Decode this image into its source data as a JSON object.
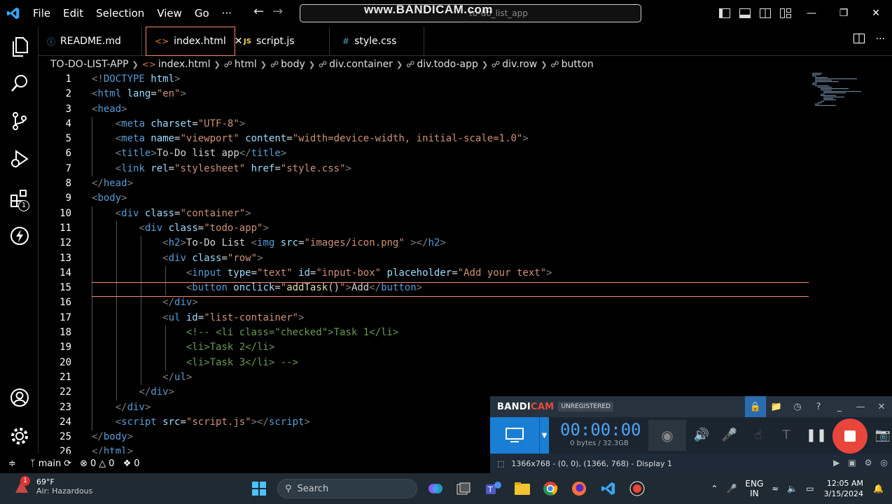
{
  "titlebar": {
    "menu": [
      "File",
      "Edit",
      "Selection",
      "View",
      "Go",
      "···"
    ],
    "search_text": "to-do_list_app",
    "watermark": "www.BANDICAM.com"
  },
  "tabs": [
    {
      "label": "README.md",
      "icon": "info-icon"
    },
    {
      "label": "index.html",
      "icon": "html-icon",
      "active": true
    },
    {
      "label": "script.js",
      "icon": "js-icon"
    },
    {
      "label": "style.css",
      "icon": "css-icon"
    }
  ],
  "breadcrumb": [
    "TO-DO-LIST-APP",
    "index.html",
    "html",
    "body",
    "div.container",
    "div.todo-app",
    "div.row",
    "button"
  ],
  "editor": {
    "lines": [
      [
        [
          "t",
          "<!"
        ],
        [
          "tg",
          "DOCTYPE"
        ],
        [
          "at",
          " html"
        ],
        [
          "t",
          ">"
        ]
      ],
      [
        [
          "t",
          "<"
        ],
        [
          "tg",
          "html"
        ],
        [
          "at",
          " lang"
        ],
        [
          "tx",
          "="
        ],
        [
          "st",
          "\"en\""
        ],
        [
          "t",
          ">"
        ]
      ],
      [
        [
          "t",
          "<"
        ],
        [
          "tg",
          "head"
        ],
        [
          "t",
          ">"
        ]
      ],
      [
        [
          "tx",
          "    "
        ],
        [
          "t",
          "<"
        ],
        [
          "tg",
          "meta"
        ],
        [
          "at",
          " charset"
        ],
        [
          "tx",
          "="
        ],
        [
          "st",
          "\"UTF-8\""
        ],
        [
          "t",
          ">"
        ]
      ],
      [
        [
          "tx",
          "    "
        ],
        [
          "t",
          "<"
        ],
        [
          "tg",
          "meta"
        ],
        [
          "at",
          " name"
        ],
        [
          "tx",
          "="
        ],
        [
          "st",
          "\"viewport\""
        ],
        [
          "at",
          " content"
        ],
        [
          "tx",
          "="
        ],
        [
          "st",
          "\"width=device-width, initial-scale=1.0\""
        ],
        [
          "t",
          ">"
        ]
      ],
      [
        [
          "tx",
          "    "
        ],
        [
          "t",
          "<"
        ],
        [
          "tg",
          "title"
        ],
        [
          "t",
          ">"
        ],
        [
          "tx",
          "To-Do list app"
        ],
        [
          "t",
          "</"
        ],
        [
          "tg",
          "title"
        ],
        [
          "t",
          ">"
        ]
      ],
      [
        [
          "tx",
          "    "
        ],
        [
          "t",
          "<"
        ],
        [
          "tg",
          "link"
        ],
        [
          "at",
          " rel"
        ],
        [
          "tx",
          "="
        ],
        [
          "st",
          "\"stylesheet\""
        ],
        [
          "at",
          " href"
        ],
        [
          "tx",
          "="
        ],
        [
          "st",
          "\"style.css\""
        ],
        [
          "t",
          ">"
        ]
      ],
      [
        [
          "t",
          "</"
        ],
        [
          "tg",
          "head"
        ],
        [
          "t",
          ">"
        ]
      ],
      [
        [
          "t",
          "<"
        ],
        [
          "tg",
          "body"
        ],
        [
          "t",
          ">"
        ]
      ],
      [
        [
          "tx",
          "    "
        ],
        [
          "t",
          "<"
        ],
        [
          "tg",
          "div"
        ],
        [
          "at",
          " class"
        ],
        [
          "tx",
          "="
        ],
        [
          "st",
          "\"container\""
        ],
        [
          "t",
          ">"
        ]
      ],
      [
        [
          "tx",
          "        "
        ],
        [
          "t",
          "<"
        ],
        [
          "tg",
          "div"
        ],
        [
          "at",
          " class"
        ],
        [
          "tx",
          "="
        ],
        [
          "st",
          "\"todo-app\""
        ],
        [
          "t",
          ">"
        ]
      ],
      [
        [
          "tx",
          "            "
        ],
        [
          "t",
          "<"
        ],
        [
          "tg",
          "h2"
        ],
        [
          "t",
          ">"
        ],
        [
          "tx",
          "To-Do List "
        ],
        [
          "t",
          "<"
        ],
        [
          "tg",
          "img"
        ],
        [
          "at",
          " src"
        ],
        [
          "tx",
          "="
        ],
        [
          "st",
          "\"images/icon.png\""
        ],
        [
          "t",
          " ></"
        ],
        [
          "tg",
          "h2"
        ],
        [
          "t",
          ">"
        ]
      ],
      [
        [
          "tx",
          "            "
        ],
        [
          "t",
          "<"
        ],
        [
          "tg",
          "div"
        ],
        [
          "at",
          " class"
        ],
        [
          "tx",
          "="
        ],
        [
          "st",
          "\"row\""
        ],
        [
          "t",
          ">"
        ]
      ],
      [
        [
          "tx",
          "                "
        ],
        [
          "t",
          "<"
        ],
        [
          "tg",
          "input"
        ],
        [
          "at",
          " type"
        ],
        [
          "tx",
          "="
        ],
        [
          "st",
          "\"text\""
        ],
        [
          "at",
          " id"
        ],
        [
          "tx",
          "="
        ],
        [
          "st",
          "\"input-box\""
        ],
        [
          "at",
          " placeholder"
        ],
        [
          "tx",
          "="
        ],
        [
          "st",
          "\"Add your text\""
        ],
        [
          "t",
          ">"
        ]
      ],
      [
        [
          "tx",
          "                "
        ],
        [
          "t",
          "<"
        ],
        [
          "tg",
          "button"
        ],
        [
          "at",
          " onclick"
        ],
        [
          "tx",
          "="
        ],
        [
          "st",
          "\""
        ],
        [
          "fn",
          "addTask"
        ],
        [
          "tx",
          "()"
        ],
        [
          "st",
          "\""
        ],
        [
          "t",
          ">"
        ],
        [
          "tx",
          "Add"
        ],
        [
          "t",
          "</"
        ],
        [
          "tg",
          "button"
        ],
        [
          "t",
          ">"
        ]
      ],
      [
        [
          "tx",
          "            "
        ],
        [
          "t",
          "</"
        ],
        [
          "tg",
          "div"
        ],
        [
          "t",
          ">"
        ]
      ],
      [
        [
          "tx",
          "            "
        ],
        [
          "t",
          "<"
        ],
        [
          "tg",
          "ul"
        ],
        [
          "at",
          " id"
        ],
        [
          "tx",
          "="
        ],
        [
          "st",
          "\"list-container\""
        ],
        [
          "t",
          ">"
        ]
      ],
      [
        [
          "tx",
          "                "
        ],
        [
          "cm",
          "<!-- <li class=\"checked\">Task 1</li>"
        ]
      ],
      [
        [
          "tx",
          "                "
        ],
        [
          "cm",
          "<li>Task 2</li>"
        ]
      ],
      [
        [
          "tx",
          "                "
        ],
        [
          "cm",
          "<li>Task 3</li> -->"
        ]
      ],
      [
        [
          "tx",
          "            "
        ],
        [
          "t",
          "</"
        ],
        [
          "tg",
          "ul"
        ],
        [
          "t",
          ">"
        ]
      ],
      [
        [
          "tx",
          "        "
        ],
        [
          "t",
          "</"
        ],
        [
          "tg",
          "div"
        ],
        [
          "t",
          ">"
        ]
      ],
      [
        [
          "tx",
          "    "
        ],
        [
          "t",
          "</"
        ],
        [
          "tg",
          "div"
        ],
        [
          "t",
          ">"
        ]
      ],
      [
        [
          "tx",
          "    "
        ],
        [
          "t",
          "<"
        ],
        [
          "tg",
          "script"
        ],
        [
          "at",
          " src"
        ],
        [
          "tx",
          "="
        ],
        [
          "st",
          "\"script.js\""
        ],
        [
          "t",
          "></"
        ],
        [
          "tg",
          "script"
        ],
        [
          "t",
          ">"
        ]
      ],
      [
        [
          "t",
          "</"
        ],
        [
          "tg",
          "body"
        ],
        [
          "t",
          ">"
        ]
      ],
      [
        [
          "t",
          "</"
        ],
        [
          "tg",
          "html"
        ],
        [
          "t",
          ">"
        ]
      ]
    ]
  },
  "statusbar": {
    "branch": "main",
    "errors": "0",
    "warnings": "0",
    "ports": "0"
  },
  "bandicam": {
    "logo_a": "BANDI",
    "logo_b": "CAM",
    "unregistered": "UNREGISTERED",
    "timer": "00:00:00",
    "size": "0 bytes / 32.3GB",
    "region": "1366x768 - (0, 0), (1366, 768) - Display 1"
  },
  "taskbar": {
    "temp": "69°F",
    "weather_desc": "Air: Hazardous",
    "weather_badge": "1",
    "search": "Search",
    "lang1": "ENG",
    "lang2": "IN",
    "time": "12:05 AM",
    "date": "3/15/2024"
  },
  "colors": {
    "accent_active_tab": "#f48771",
    "bandicam_blue": "#1a7fd4",
    "record_red": "#e8453c"
  }
}
